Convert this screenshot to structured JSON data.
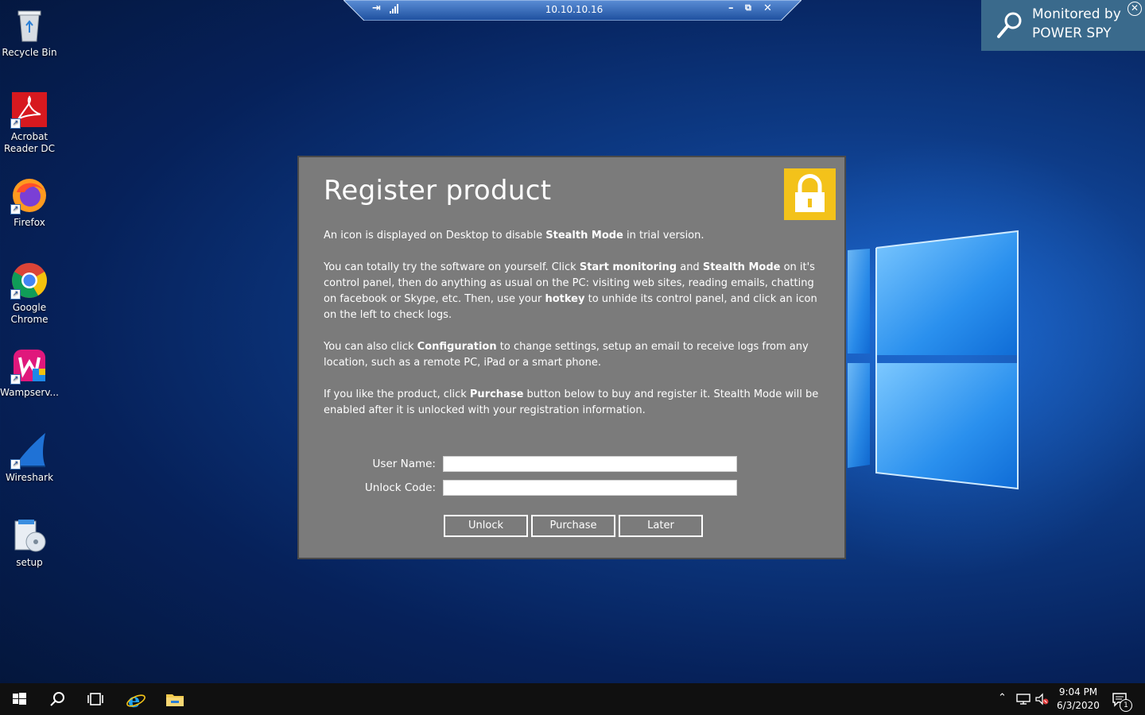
{
  "desktop": {
    "icons": [
      {
        "label": "Recycle Bin"
      },
      {
        "label": "Acrobat Reader DC"
      },
      {
        "label": "Firefox"
      },
      {
        "label": "Google Chrome"
      },
      {
        "label": "Wampserv..."
      },
      {
        "label": "Wireshark"
      },
      {
        "label": "setup"
      }
    ]
  },
  "rdp_bar": {
    "host": "10.10.10.16",
    "minimize": "–",
    "restore": "⧉",
    "close": "✕"
  },
  "monitor_badge": {
    "line1": "Monitored by",
    "line2": "POWER SPY",
    "close": "✕"
  },
  "dialog": {
    "title": "Register product",
    "p1": {
      "a": "An icon is displayed on Desktop to disable ",
      "b": "Stealth Mode",
      "c": " in trial version."
    },
    "p2": {
      "a": "You can totally try the software on yourself. Click ",
      "b": "Start monitoring",
      "c": " and ",
      "d": "Stealth Mode",
      "e": " on it's control panel, then do anything as usual on the PC: visiting web sites, reading emails, chatting on facebook or Skype, etc. Then, use your ",
      "f": "hotkey",
      "g": " to unhide its control panel, and click an icon on the left to check logs."
    },
    "p3": {
      "a": "You can also click ",
      "b": "Configuration",
      "c": " to change settings, setup an email to receive logs from any location, such as a remote PC, iPad or a smart phone."
    },
    "p4": {
      "a": "If you like the product, click ",
      "b": "Purchase",
      "c": " button below to buy and register it. Stealth Mode will be enabled after it is unlocked with your registration information."
    },
    "user_name_label": "User Name:",
    "user_name_value": "",
    "unlock_code_label": "Unlock Code:",
    "unlock_code_value": "",
    "buttons": {
      "unlock": "Unlock",
      "purchase": "Purchase",
      "later": "Later"
    }
  },
  "taskbar": {
    "time": "9:04 PM",
    "date": "6/3/2020",
    "notification_count": "1"
  },
  "colors": {
    "dialog_bg": "#7b7b7b",
    "lock_bg": "#f3c21a",
    "monitor_bg": "#3a6a8c",
    "taskbar_bg": "#101010"
  }
}
